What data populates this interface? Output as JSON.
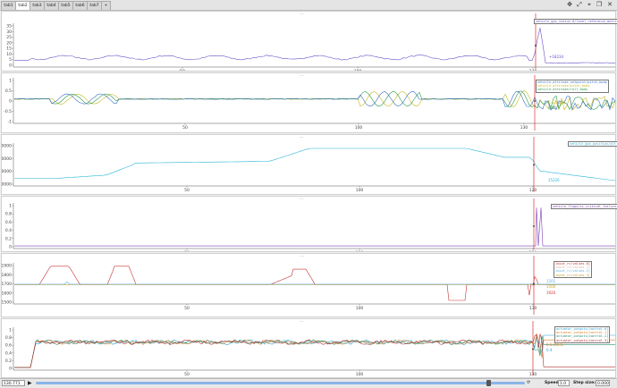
{
  "tabs": [
    "tab1",
    "tab2",
    "tab3",
    "tab4",
    "tab5",
    "tab6",
    "tab7"
  ],
  "active_tab": 1,
  "toolbar_icons": [
    "move-icon",
    "expand-icon",
    "crosshair-icon",
    "window-icon",
    "close-icon"
  ],
  "cursor_x": 130.8,
  "plots": [
    {
      "y_ticks": [
        "35",
        "30",
        "25",
        "20",
        "15",
        "10",
        "5",
        "0"
      ],
      "x_ticks": [
        "50",
        "100",
        "130"
      ],
      "legend": [
        {
          "text": "vehicle_gps_status.0/level_reference_metric",
          "color": "#6a4fc8"
        }
      ],
      "annotations": [
        {
          "text": "+18234",
          "color": "#6a4fc8"
        }
      ]
    },
    {
      "y_ticks": [
        "1",
        "0.5",
        "0",
        "-0.5",
        "-1"
      ],
      "x_ticks": [
        "50",
        "100",
        "130"
      ],
      "legend": [
        {
          "text": "vehicle_attitude_setpoint/pitch_body",
          "color": "#3a6fbf"
        },
        {
          "text": "vehicle_attitude/pitch_body",
          "color": "#c8b820"
        },
        {
          "text": "vehicle_attitude/roll_body",
          "color": "#2a9a4a"
        }
      ],
      "annotations": [
        {
          "text": "0.121166",
          "color": "#c8b820"
        },
        {
          "text": "0.15",
          "color": "#2a9a4a"
        }
      ]
    },
    {
      "y_ticks": [
        "40000",
        "30000",
        "20000",
        "10000"
      ],
      "x_ticks": [
        "50",
        "100",
        "120"
      ],
      "legend": [
        {
          "text": "vehicle_gps_position/alt",
          "color": "#29b6d8"
        }
      ],
      "annotations": [
        {
          "text": "35226",
          "color": "#29b6d8"
        }
      ]
    },
    {
      "y_ticks": [
        "1",
        "0.8",
        "0.6",
        "0.4",
        "0.2",
        "0"
      ],
      "x_ticks": [
        "50",
        "100",
        "130"
      ],
      "legend": [
        {
          "text": "vehicle_flags/is_critical_failure",
          "color": "#7a3fb8"
        }
      ],
      "annotations": []
    },
    {
      "y_ticks": [
        "1900",
        "1800",
        "1700",
        "1600",
        "1500"
      ],
      "x_ticks": [
        "50",
        "100",
        "130"
      ],
      "legend": [
        {
          "text": "input_rc/values.0]",
          "color": "#c83030"
        },
        {
          "text": "input_rc/values.1]",
          "color": "#e0b0b0"
        },
        {
          "text": "input_rc/values.2]",
          "color": "#5aaee0"
        },
        {
          "text": "input_rc/values.3]",
          "color": "#c8a020"
        }
      ],
      "annotations": [
        {
          "text": "1501",
          "color": "#5aaee0"
        },
        {
          "text": "1500",
          "color": "#c8a020"
        },
        {
          "text": "1920",
          "color": "#c83030"
        }
      ]
    },
    {
      "y_ticks": [
        "1",
        "0.8",
        "0.6",
        "0.4",
        "0.2",
        "0"
      ],
      "x_ticks": [
        "50",
        "100",
        "130"
      ],
      "legend": [
        {
          "text": "actuator_outputs/control.0]",
          "color": "#29a0d0"
        },
        {
          "text": "actuator_outputs/control.1]",
          "color": "#e08020"
        },
        {
          "text": "actuator_outputs/control.2]",
          "color": "#2a8a6a"
        },
        {
          "text": "actuator_outputs/control.3]",
          "color": "#b03030"
        }
      ],
      "annotations": [
        {
          "text": "0.534871",
          "color": "#e08020"
        },
        {
          "text": "0.4",
          "color": "#29a0d0"
        }
      ]
    }
  ],
  "status": {
    "time": "130.771",
    "speed_label": "Speed:",
    "speed_value": "1.0",
    "step_label": "Step size:",
    "step_value": "0.000",
    "playback_fraction": 0.925
  }
}
